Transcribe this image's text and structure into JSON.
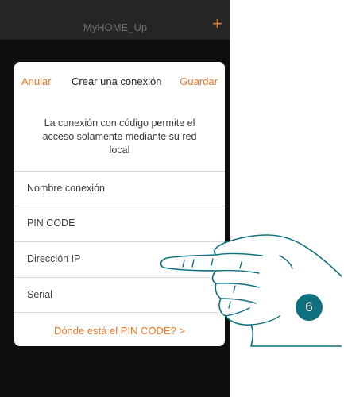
{
  "app": {
    "title": "MyHOME_Up",
    "add_icon": "+",
    "accent_color": "#e8792b"
  },
  "dialog": {
    "cancel_label": "Anular",
    "title": "Crear una conexión",
    "save_label": "Guardar",
    "description": "La conexión con código permite el acceso solamente mediante su red local",
    "fields": [
      {
        "label": "Nombre conexión"
      },
      {
        "label": "PIN CODE"
      },
      {
        "label": "Dirección IP"
      },
      {
        "label": "Serial"
      }
    ],
    "pin_link": "Dónde está el PIN CODE? >"
  },
  "step": {
    "number": "6",
    "color": "#0f707f"
  }
}
